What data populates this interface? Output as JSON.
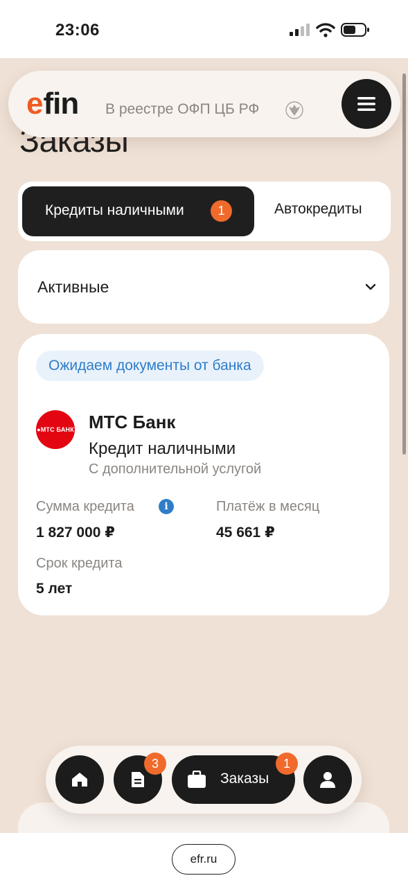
{
  "status_bar": {
    "time": "23:06"
  },
  "header": {
    "logo_e": "e",
    "logo_rest": "fin",
    "registry_text": "В реестре ОФП ЦБ РФ"
  },
  "page": {
    "title": "Заказы"
  },
  "tabs": [
    {
      "label": "Кредиты наличными",
      "badge": "1",
      "active": true
    },
    {
      "label": "Автокредиты",
      "active": false
    }
  ],
  "filter": {
    "selected": "Активные"
  },
  "order": {
    "status": "Ожидаем документы от банка",
    "bank_logo_text": "●МТС БАНК",
    "bank_name": "МТС Банк",
    "product": "Кредит наличными",
    "product_note": "С дополнительной услугой",
    "amount_label": "Сумма кредита",
    "amount_value": "1 827 000 ₽",
    "payment_label": "Платёж в месяц",
    "payment_value": "45 661 ₽",
    "term_label": "Срок кредита",
    "term_value": "5 лет"
  },
  "bottom_nav": {
    "docs_badge": "3",
    "orders_label": "Заказы",
    "orders_badge": "1"
  },
  "browser": {
    "url": "efr.ru"
  },
  "colors": {
    "accent": "#ef5a22",
    "background": "#efe1d6",
    "dark": "#1c1c1c",
    "status_blue": "#2f7dc8",
    "bank_red": "#e30611"
  }
}
